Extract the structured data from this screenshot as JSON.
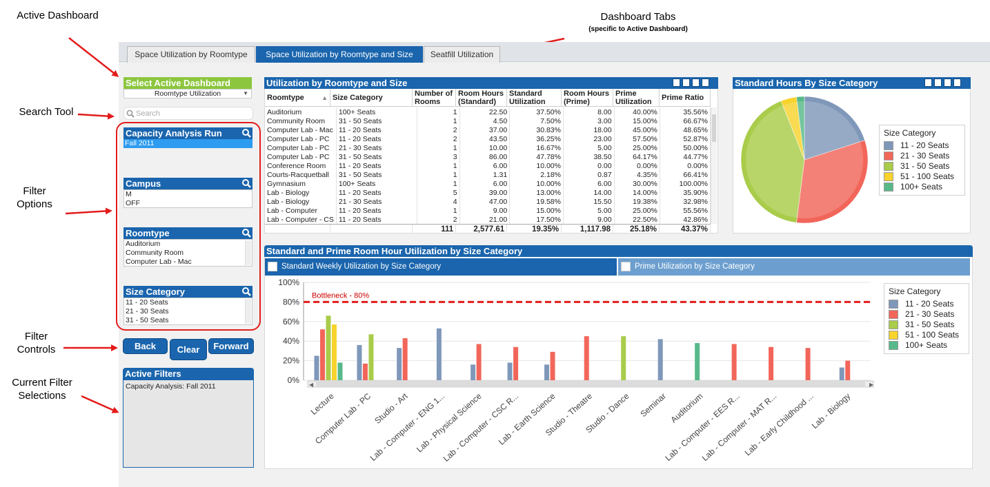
{
  "callouts": {
    "active_dashboard": "Active Dashboard",
    "dashboard_tabs": "Dashboard Tabs",
    "dashboard_tabs_sub": "(specific to Active Dashboard)",
    "search_tool": "Search Tool",
    "filter_options_1": "Filter",
    "filter_options_2": "Options",
    "filter_controls_1": "Filter",
    "filter_controls_2": "Controls",
    "current_filter_1": "Current Filter",
    "current_filter_2": "Selections"
  },
  "tabs": [
    "Space Utilization by Roomtype",
    "Space Utilization by Roomtype and Size",
    "Seatfill Utilization"
  ],
  "sidebar": {
    "select_dashboard_title": "Select Active Dashboard",
    "select_dashboard_value": "Roomtype Utilization",
    "search_placeholder": "Search",
    "capacity_title": "Capacity Analysis Run",
    "capacity_items": [
      "Fall 2011"
    ],
    "campus_title": "Campus",
    "campus_items": [
      "M",
      "OFF"
    ],
    "roomtype_title": "Roomtype",
    "roomtype_items": [
      "Auditorium",
      "Community Room",
      "Computer Lab - Mac"
    ],
    "size_title": "Size Category",
    "size_items": [
      "11 - 20 Seats",
      "21 - 30 Seats",
      "31 - 50 Seats"
    ],
    "back": "Back",
    "clear": "Clear",
    "forward": "Forward",
    "active_filters_title": "Active Filters",
    "active_filters_text": "Capacity Analysis: Fall 2011"
  },
  "table": {
    "title": "Utilization by Roomtype and Size",
    "headers": [
      "Roomtype",
      "Size Category",
      "Number of Rooms",
      "Room Hours (Standard)",
      "Standard Utilization",
      "Room Hours (Prime)",
      "Prime Utilization",
      "Prime Ratio"
    ],
    "rows": [
      [
        "Auditorium",
        "100+ Seats",
        "1",
        "22.50",
        "37.50%",
        "8.00",
        "40.00%",
        "35.56%"
      ],
      [
        "Community Room",
        "31 - 50 Seats",
        "1",
        "4.50",
        "7.50%",
        "3.00",
        "15.00%",
        "66.67%"
      ],
      [
        "Computer Lab - Mac",
        "11 - 20 Seats",
        "2",
        "37.00",
        "30.83%",
        "18.00",
        "45.00%",
        "48.65%"
      ],
      [
        "Computer Lab - PC",
        "11 - 20 Seats",
        "2",
        "43.50",
        "36.25%",
        "23.00",
        "57.50%",
        "52.87%"
      ],
      [
        "Computer Lab - PC",
        "21 - 30 Seats",
        "1",
        "10.00",
        "16.67%",
        "5.00",
        "25.00%",
        "50.00%"
      ],
      [
        "Computer Lab - PC",
        "31 - 50 Seats",
        "3",
        "86.00",
        "47.78%",
        "38.50",
        "64.17%",
        "44.77%"
      ],
      [
        "Conference Room",
        "11 - 20 Seats",
        "1",
        "6.00",
        "10.00%",
        "0.00",
        "0.00%",
        "0.00%"
      ],
      [
        "Courts-Racquetball",
        "31 - 50 Seats",
        "1",
        "1.31",
        "2.18%",
        "0.87",
        "4.35%",
        "66.41%"
      ],
      [
        "Gymnasium",
        "100+ Seats",
        "1",
        "6.00",
        "10.00%",
        "6.00",
        "30.00%",
        "100.00%"
      ],
      [
        "Lab - Biology",
        "11 - 20 Seats",
        "5",
        "39.00",
        "13.00%",
        "14.00",
        "14.00%",
        "35.90%"
      ],
      [
        "Lab - Biology",
        "21 - 30 Seats",
        "4",
        "47.00",
        "19.58%",
        "15.50",
        "19.38%",
        "32.98%"
      ],
      [
        "Lab - Computer",
        "11 - 20 Seats",
        "1",
        "9.00",
        "15.00%",
        "5.00",
        "25.00%",
        "55.56%"
      ],
      [
        "Lab - Computer - CS",
        "11 - 20 Seats",
        "2",
        "21.00",
        "17.50%",
        "9.00",
        "22.50%",
        "42.86%"
      ]
    ],
    "totals": [
      "",
      "",
      "111",
      "2,577.61",
      "19.35%",
      "1,117.98",
      "25.18%",
      "43.37%"
    ]
  },
  "size_categories": [
    "11 - 20 Seats",
    "21 - 30 Seats",
    "31 - 50 Seats",
    "51 - 100 Seats",
    "100+ Seats"
  ],
  "colors": [
    "#7f98ba",
    "#f2665a",
    "#a9cc4a",
    "#f7d32c",
    "#57b98a"
  ],
  "pie": {
    "title": "Standard Hours By Size Category",
    "legend_title": "Size Category"
  },
  "bars_panel": {
    "title": "Standard and Prime Room Hour Utilization by Size Category",
    "tab_standard": "Standard Weekly Utilization by Size Category",
    "tab_prime": "Prime Utilization by Size Category",
    "legend_title": "Size Category",
    "bottleneck_label": "Bottleneck - 80%"
  },
  "chart_data": [
    {
      "type": "pie",
      "title": "Standard Hours By Size Category",
      "labels": [
        "11 - 20 Seats",
        "21 - 30 Seats",
        "31 - 50 Seats",
        "51 - 100 Seats",
        "100+ Seats"
      ],
      "values": [
        20,
        32,
        42,
        4,
        2
      ],
      "legend": "right"
    },
    {
      "type": "bar",
      "title": "Standard Weekly Utilization by Size Category",
      "categories": [
        "Lecture",
        "Computer Lab - PC",
        "Studio - Art",
        "Lab - Computer - ENG 1...",
        "Lab - Physical Science",
        "Lab - Computer - CSC R...",
        "Lab - Earth Science",
        "Studio - Theatre",
        "Studio - Dance",
        "Seminar",
        "Auditorium",
        "Lab - Computer - EES R...",
        "Lab - Computer - MAT R...",
        "Lab - Early Childhood ...",
        "Lab - Biology"
      ],
      "series": [
        {
          "name": "11 - 20 Seats",
          "values": [
            25,
            36,
            33,
            53,
            16,
            18,
            16,
            null,
            null,
            42,
            null,
            null,
            null,
            null,
            13
          ]
        },
        {
          "name": "21 - 30 Seats",
          "values": [
            52,
            17,
            43,
            null,
            37,
            34,
            29,
            45,
            null,
            null,
            null,
            37,
            34,
            33,
            20
          ]
        },
        {
          "name": "31 - 50 Seats",
          "values": [
            66,
            47,
            null,
            null,
            null,
            null,
            null,
            null,
            45,
            null,
            null,
            null,
            null,
            null,
            null
          ]
        },
        {
          "name": "51 - 100 Seats",
          "values": [
            57,
            null,
            null,
            null,
            null,
            null,
            null,
            null,
            null,
            null,
            null,
            null,
            null,
            null,
            null
          ]
        },
        {
          "name": "100+ Seats",
          "values": [
            18,
            null,
            null,
            null,
            null,
            null,
            null,
            null,
            null,
            null,
            38,
            null,
            null,
            null,
            null
          ]
        }
      ],
      "ylim": [
        0,
        100
      ],
      "yticks": [
        "0%",
        "20%",
        "40%",
        "60%",
        "80%",
        "100%"
      ],
      "reference_line": 80,
      "legend": "right"
    }
  ]
}
